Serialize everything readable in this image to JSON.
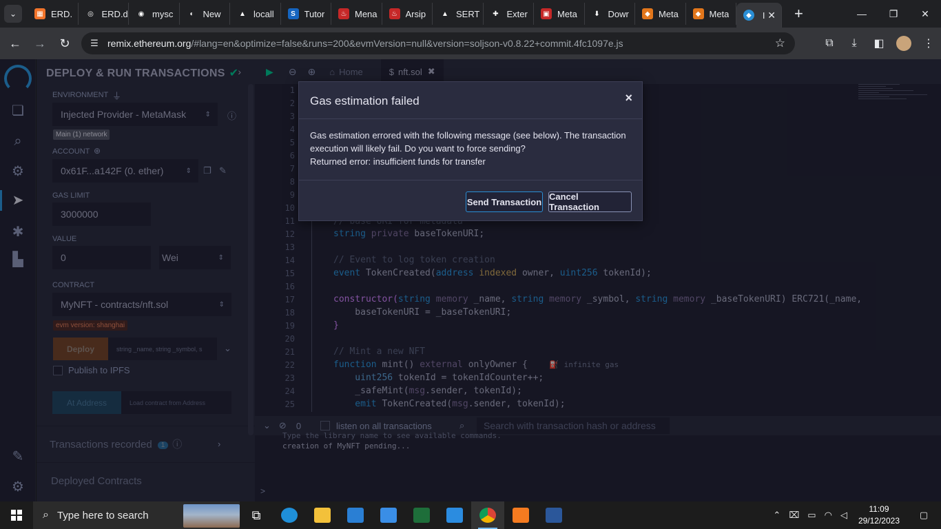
{
  "browser": {
    "tabs": [
      {
        "label": "ERD.",
        "color": "#f2742b",
        "glyph": "▦"
      },
      {
        "label": "ERD.d",
        "color": "#202124",
        "glyph": "◎"
      },
      {
        "label": "mysc",
        "color": "#202124",
        "glyph": "◉"
      },
      {
        "label": "New",
        "color": "#202124",
        "glyph": "◐"
      },
      {
        "label": "locall",
        "color": "#202124",
        "glyph": "▲"
      },
      {
        "label": "Tutor",
        "color": "#1565c0",
        "glyph": "S"
      },
      {
        "label": "Mena",
        "color": "#c62828",
        "glyph": "♨"
      },
      {
        "label": "Arsip",
        "color": "#c62828",
        "glyph": "♨"
      },
      {
        "label": "SERT",
        "color": "#202124",
        "glyph": "▲"
      },
      {
        "label": "Exter",
        "color": "#202124",
        "glyph": "✚"
      },
      {
        "label": "Meta",
        "color": "#c62828",
        "glyph": "▣"
      },
      {
        "label": "Dowr",
        "color": "#202124",
        "glyph": "⬇"
      },
      {
        "label": "Meta",
        "color": "#e2761b",
        "glyph": "◆"
      },
      {
        "label": "Meta",
        "color": "#e2761b",
        "glyph": "◆"
      }
    ],
    "active_tab": {
      "label": "I",
      "color": "#2a8fd6"
    },
    "url_host": "remix.ethereum.org",
    "url_rest": "/#lang=en&optimize=false&runs=200&evmVersion=null&version=soljson-v0.8.22+commit.4fc1097e.js"
  },
  "sidepanel": {
    "title": "DEPLOY & RUN TRANSACTIONS",
    "environment_label": "ENVIRONMENT",
    "environment_value": "Injected Provider - MetaMask",
    "network_badge": "Main (1) network",
    "account_label": "ACCOUNT",
    "account_value": "0x61F...a142F (0. ether)",
    "gas_limit_label": "GAS LIMIT",
    "gas_limit_value": "3000000",
    "value_label": "VALUE",
    "value_value": "0",
    "value_unit": "Wei",
    "contract_label": "CONTRACT",
    "contract_value": "MyNFT - contracts/nft.sol",
    "evm_badge": "evm version: shanghai",
    "deploy_label": "Deploy",
    "deploy_args": "string _name, string _symbol, s",
    "publish_label": "Publish to IPFS",
    "at_address_label": "At Address",
    "at_address_placeholder": "Load contract from Address",
    "transactions_recorded": "Transactions recorded",
    "transactions_count": "1",
    "deployed_contracts": "Deployed Contracts"
  },
  "editor": {
    "home_tab": "Home",
    "file_tab": "nft.sol",
    "line_numbers": [
      "1",
      "2",
      "3",
      "4",
      "5",
      "6",
      "7",
      "8",
      "9",
      "10",
      "11",
      "12",
      "13",
      "14",
      "15",
      "16",
      "17",
      "18",
      "19",
      "20",
      "21",
      "22",
      "23",
      "24",
      "25"
    ],
    "lines": {
      "l11": "// base URI for metadata",
      "l12a": "string",
      "l12b": "private",
      "l12c": " baseTokenURI;",
      "l14": "// Event to log token creation",
      "l15a": "event",
      "l15b": " TokenCreated(",
      "l15c": "address",
      "l15d": "indexed",
      "l15e": " owner, ",
      "l15f": "uint256",
      "l15g": " tokenId);",
      "l17a": "constructor(",
      "l17b": "string",
      "l17c": "memory",
      "l17d": " _name, ",
      "l17e": "string",
      "l17f": "memory",
      "l17g": " _symbol, ",
      "l17h": "string",
      "l17i": "memory",
      "l17j": " _baseTokenURI) ERC721(_name,",
      "l18": "    baseTokenURI = _baseTokenURI;",
      "l19": "}",
      "l21": "// Mint a new NFT",
      "l22a": "function",
      "l22b": " mint() ",
      "l22c": "external",
      "l22d": " onlyOwner {",
      "l22gas": "infinite gas",
      "l23a": "    uint256",
      "l23b": " tokenId = tokenIdCounter++;",
      "l24a": "    _safeMint(",
      "l24b": "msg",
      "l24c": ".sender, tokenId);",
      "l25a": "    emit",
      "l25b": " TokenCreated(",
      "l25c": "msg",
      "l25d": ".sender, tokenId);"
    }
  },
  "terminal": {
    "count": "0",
    "listen_label": "listen on all transactions",
    "search_placeholder": "Search with transaction hash or address",
    "line1": "Type the library name to see available commands.",
    "line2": "creation of MyNFT pending...",
    "prompt": ">"
  },
  "modal": {
    "title": "Gas estimation failed",
    "close": "×",
    "body1": "Gas estimation errored with the following message (see below). The transaction execution will likely fail. Do you want to force sending?",
    "body2": "Returned error: insufficient funds for transfer",
    "send_label": "Send Transaction",
    "cancel_label": "Cancel Transaction"
  },
  "taskbar": {
    "search_placeholder": "Type here to search",
    "time": "11:09",
    "date": "29/12/2023"
  }
}
